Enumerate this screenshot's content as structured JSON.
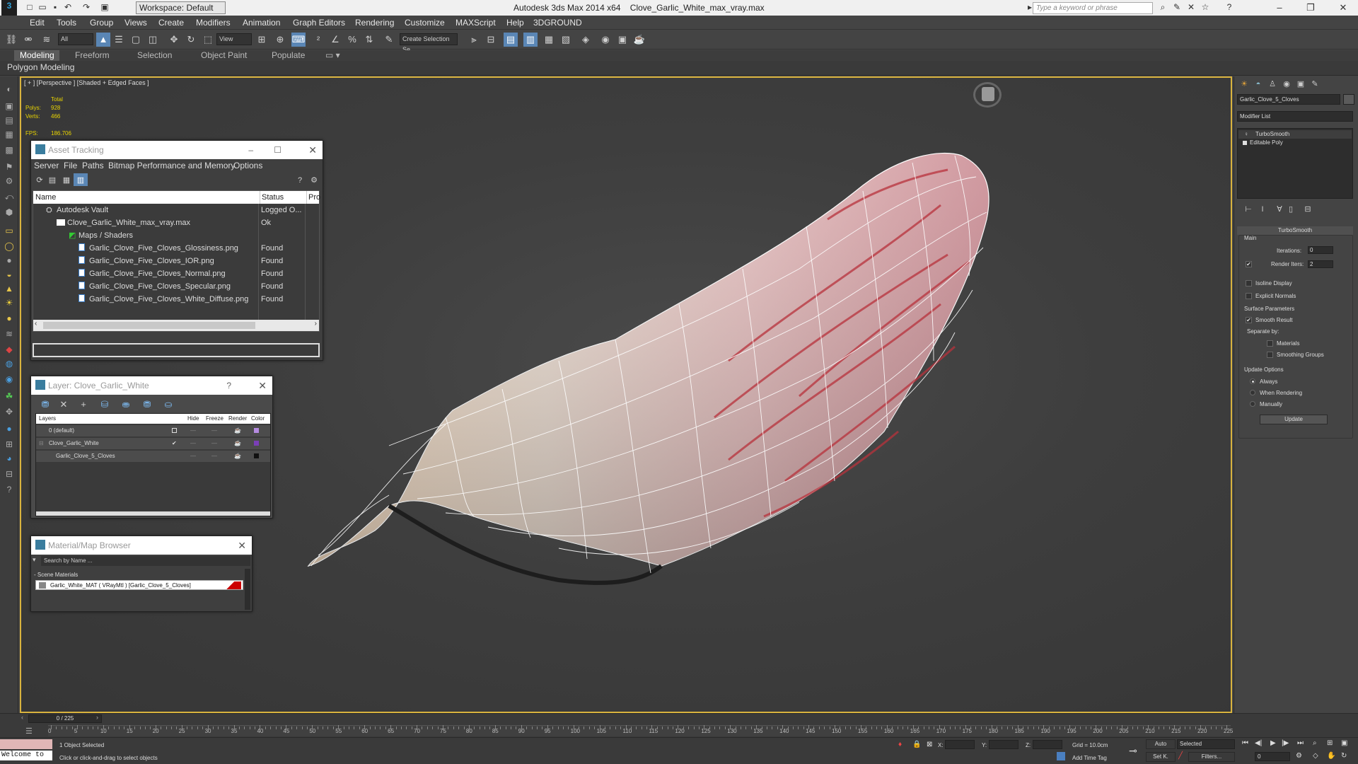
{
  "title": {
    "app": "Autodesk 3ds Max  2014 x64",
    "file": "Clove_Garlic_White_max_vray.max",
    "workspace": "Workspace: Default",
    "search_placeholder": "Type a keyword or phrase"
  },
  "menu": [
    "Edit",
    "Tools",
    "Group",
    "Views",
    "Create",
    "Modifiers",
    "Animation",
    "Graph Editors",
    "Rendering",
    "Customize",
    "MAXScript",
    "Help",
    "3DGROUND"
  ],
  "toolbar": {
    "filter": "All",
    "coord": "View",
    "selection_set": "Create Selection Se"
  },
  "ribbon": {
    "tabs": [
      "Modeling",
      "Freeform",
      "Selection",
      "Object Paint",
      "Populate"
    ],
    "subtab": "Polygon Modeling"
  },
  "viewport": {
    "label": "[ + ] [Perspective ] [Shaded + Edged Faces ]",
    "stats_header": "Total",
    "polys_label": "Polys:",
    "polys": "928",
    "verts_label": "Verts:",
    "verts": "466",
    "fps_label": "FPS:",
    "fps": "186.706"
  },
  "asset_tracking": {
    "title": "Asset Tracking",
    "menu": [
      "Server",
      "File",
      "Paths",
      "Bitmap Performance and Memory",
      "Options"
    ],
    "columns": [
      "Name",
      "Status",
      "Pro"
    ],
    "rows": [
      {
        "name": "Autodesk Vault",
        "status": "Logged O..."
      },
      {
        "name": "Clove_Garlic_White_max_vray.max",
        "status": "Ok"
      },
      {
        "name": "Maps / Shaders",
        "status": ""
      },
      {
        "name": "Garlic_Clove_Five_Cloves_Glossiness.png",
        "status": "Found"
      },
      {
        "name": "Garlic_Clove_Five_Cloves_IOR.png",
        "status": "Found"
      },
      {
        "name": "Garlic_Clove_Five_Cloves_Normal.png",
        "status": "Found"
      },
      {
        "name": "Garlic_Clove_Five_Cloves_Specular.png",
        "status": "Found"
      },
      {
        "name": "Garlic_Clove_Five_Cloves_White_Diffuse.png",
        "status": "Found"
      }
    ]
  },
  "layer_window": {
    "title": "Layer: Clove_Garlic_White",
    "help": "?",
    "columns": [
      "Layers",
      "Hide",
      "Freeze",
      "Render",
      "Color"
    ],
    "rows": [
      {
        "name": "0 (default)",
        "color": "#b58be0"
      },
      {
        "name": "Clove_Garlic_White",
        "color": "#7a3fb8"
      },
      {
        "name": "Garlic_Clove_5_Cloves",
        "color": "#111111"
      }
    ]
  },
  "material_browser": {
    "title": "Material/Map Browser",
    "search_placeholder": "Search by Name ...",
    "section": "- Scene Materials",
    "item": "Garlic_White_MAT ( VRayMtl ) [Garlic_Clove_5_Cloves]"
  },
  "command_panel": {
    "object_name": "Garlic_Clove_5_Cloves",
    "modifier_list": "Modifier List",
    "stack": [
      "TurboSmooth",
      "Editable Poly"
    ],
    "rollout": "TurboSmooth",
    "main": "Main",
    "iterations_label": "Iterations:",
    "iterations": "0",
    "render_iters_label": "Render Iters:",
    "render_iters": "2",
    "isoline": "Isoline Display",
    "explicit": "Explicit Normals",
    "surface_params": "Surface Parameters",
    "smooth_result": "Smooth Result",
    "separate_by": "Separate by:",
    "materials": "Materials",
    "smoothing_groups": "Smoothing Groups",
    "update_options": "Update Options",
    "always": "Always",
    "when_rendering": "When Rendering",
    "manually": "Manually",
    "update_btn": "Update"
  },
  "timeline": {
    "frame": "0 / 225",
    "ticks": [
      "0",
      "5",
      "10",
      "15",
      "20",
      "25",
      "30",
      "35",
      "40",
      "45",
      "50",
      "55",
      "60",
      "65",
      "70",
      "75",
      "80",
      "85",
      "90",
      "95",
      "100",
      "105",
      "110",
      "115",
      "120",
      "125",
      "130",
      "135",
      "140",
      "145",
      "150",
      "155",
      "160",
      "165",
      "170",
      "175",
      "180",
      "185",
      "190",
      "195",
      "200",
      "205",
      "210",
      "215",
      "220",
      "225"
    ]
  },
  "status": {
    "welcome": "Welcome to",
    "selected": "1 Object Selected",
    "prompt": "Click or click-and-drag to select objects",
    "x_label": "X:",
    "y_label": "Y:",
    "z_label": "Z:",
    "grid": "Grid = 10.0cm",
    "add_time_tag": "Add Time Tag",
    "auto": "Auto",
    "set_k": "Set K.",
    "selected_drop": "Selected",
    "filters": "Filters...",
    "frame_field": "0"
  }
}
